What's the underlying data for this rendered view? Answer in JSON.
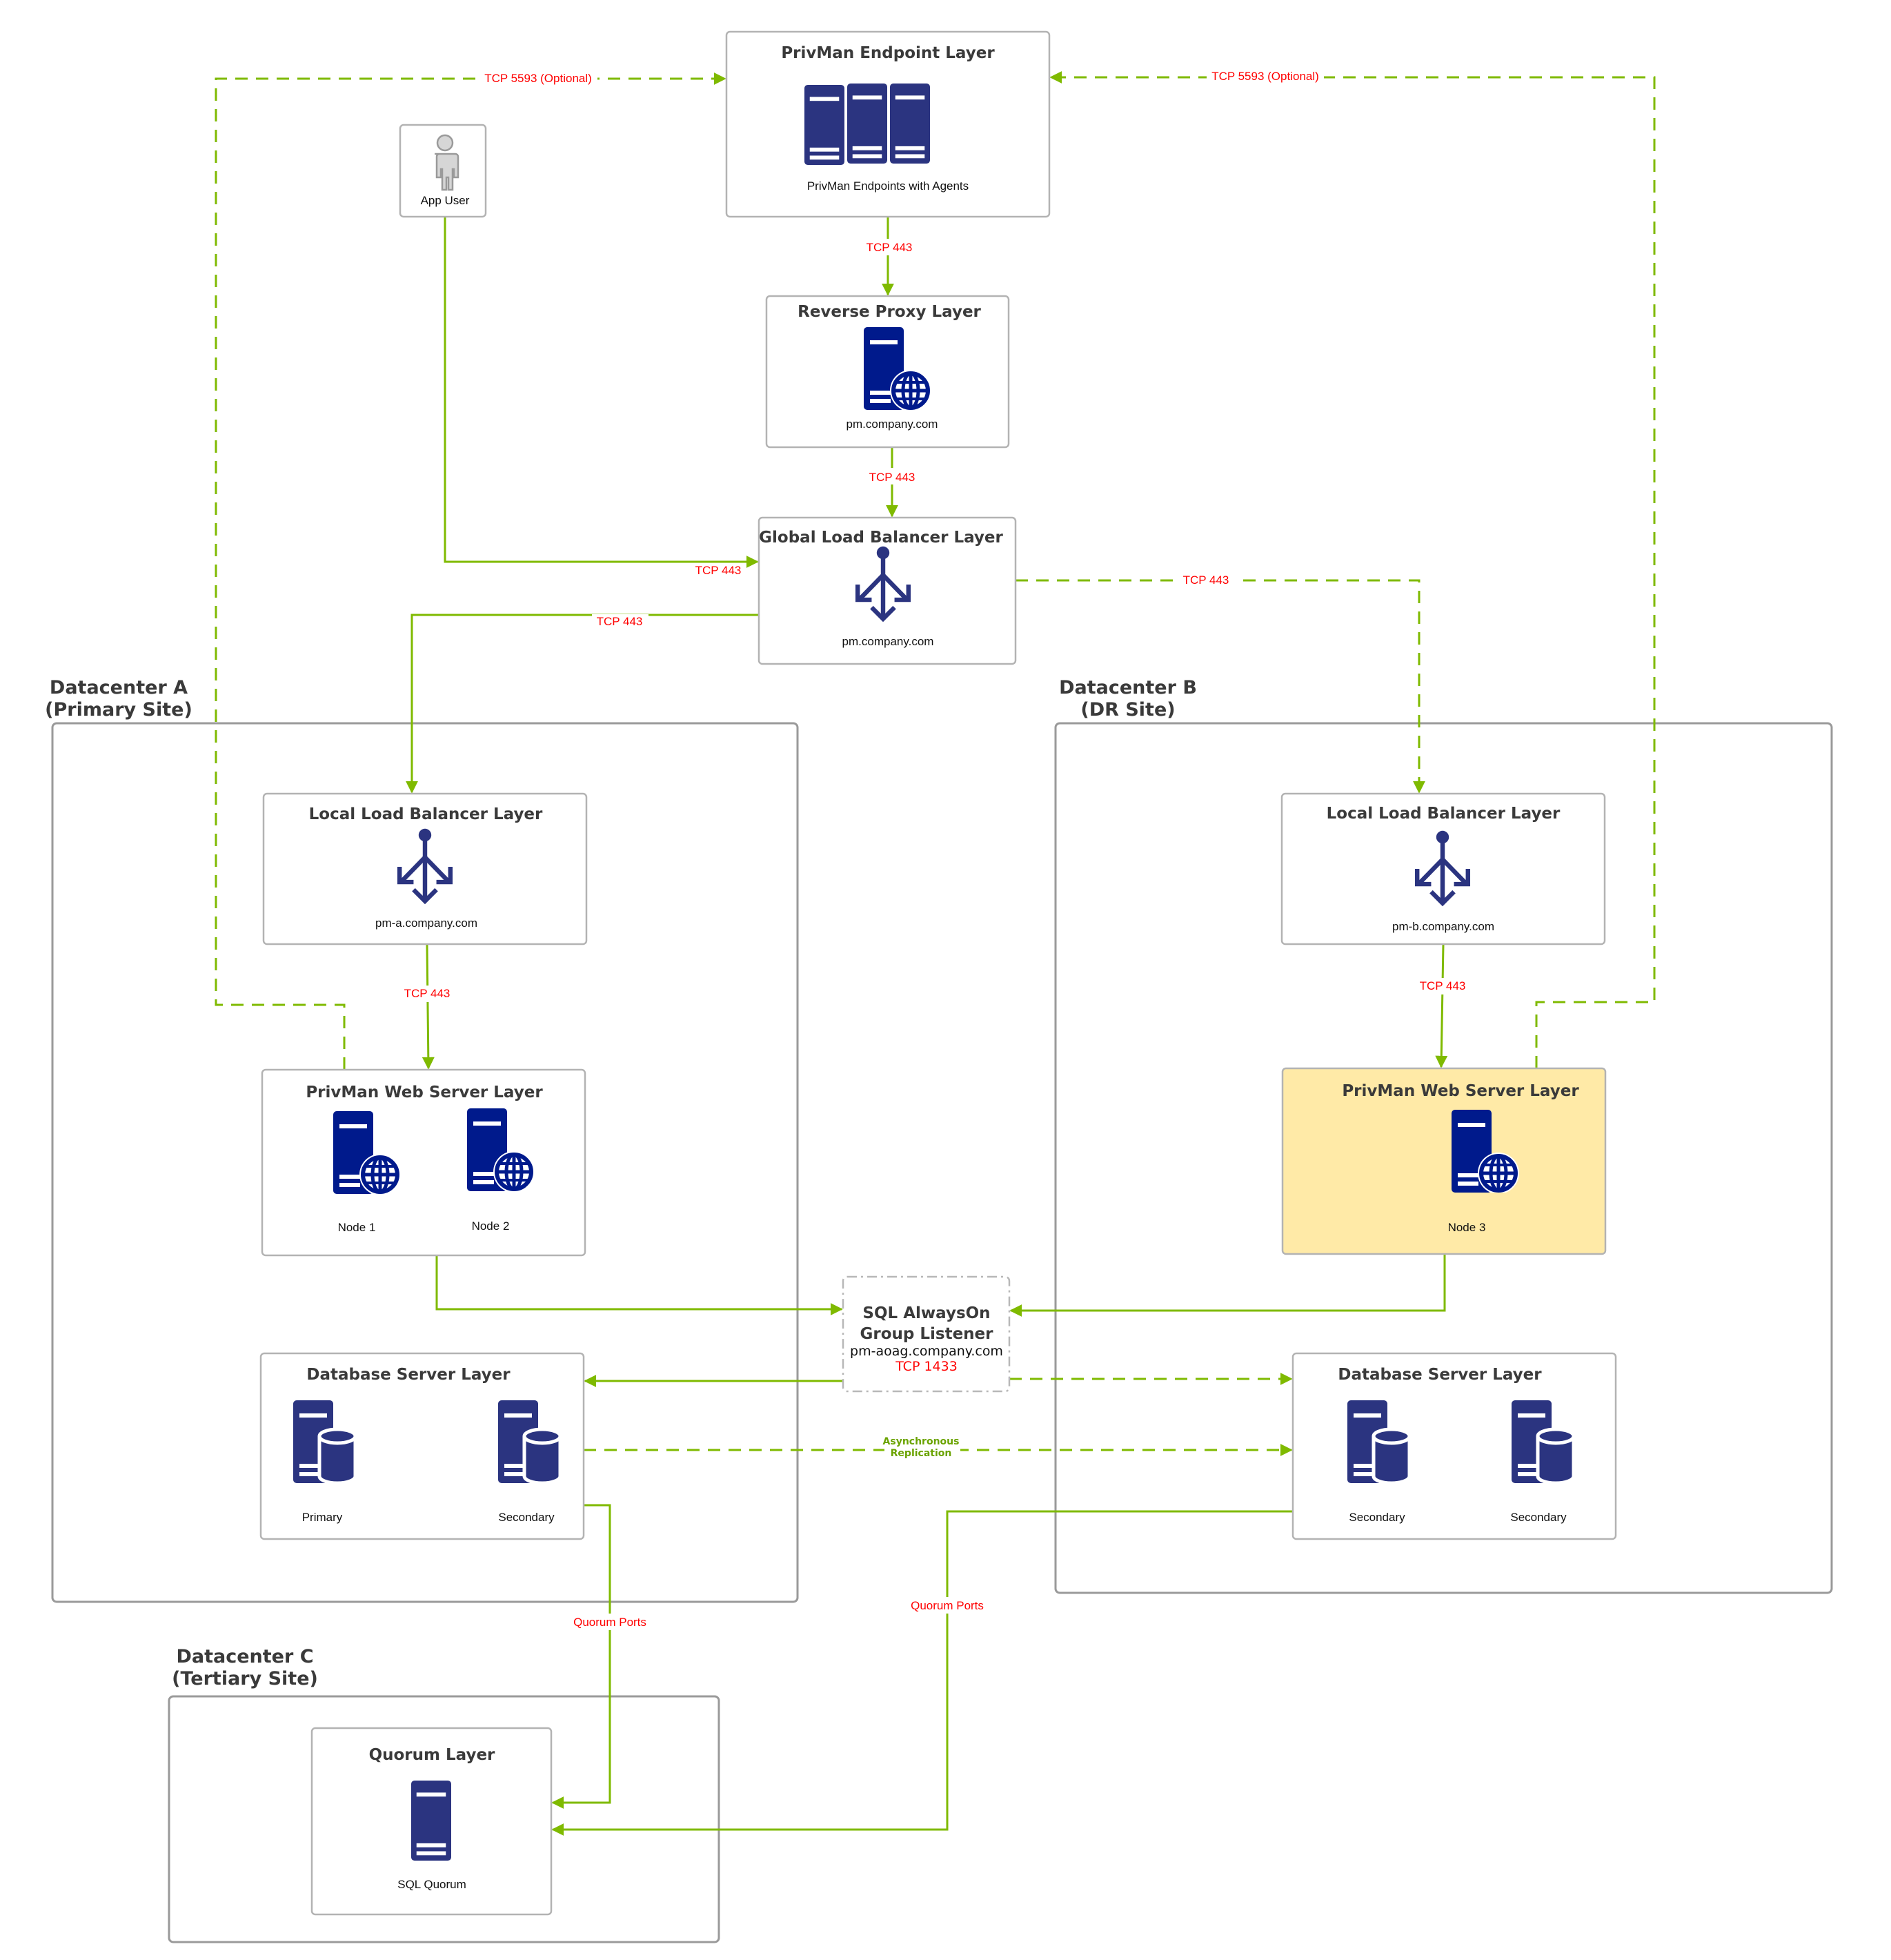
{
  "colors": {
    "connector": "#7fba00",
    "port_label": "#ff0000",
    "server_icon": "#2b3480",
    "web_server_icon": "#001a8c",
    "highlight_fill": "#ffeaa7",
    "box_border": "#b3b3b3"
  },
  "endpoint_layer": {
    "title": "PrivMan Endpoint Layer",
    "subtitle": "PrivMan Endpoints with Agents",
    "icon": "server-rack-icon"
  },
  "app_user": {
    "label": "App User",
    "icon": "user-icon"
  },
  "reverse_proxy": {
    "title": "Reverse Proxy Layer",
    "host": "pm.company.com",
    "icon": "web-server-icon"
  },
  "global_lb": {
    "title": "Global Load Balancer Layer",
    "host": "pm.company.com",
    "icon": "load-balancer-icon"
  },
  "datacenters": {
    "a": {
      "name": "Datacenter A",
      "site": "(Primary Site)",
      "local_lb": {
        "title": "Local Load Balancer Layer",
        "host": "pm-a.company.com"
      },
      "web_layer": {
        "title": "PrivMan Web Server Layer",
        "nodes": [
          "Node 1",
          "Node 2"
        ]
      },
      "db_layer": {
        "title": "Database Server Layer",
        "servers": [
          "Primary",
          "Secondary"
        ],
        "replication": [
          "Asynchronous",
          "Replication"
        ]
      }
    },
    "b": {
      "name": "Datacenter B",
      "site": "(DR Site)",
      "local_lb": {
        "title": "Local Load Balancer Layer",
        "host": "pm-b.company.com"
      },
      "web_layer": {
        "title": "PrivMan Web Server Layer",
        "nodes": [
          "Node 3"
        ]
      },
      "db_layer": {
        "title": "Database Server Layer",
        "servers": [
          "Secondary",
          "Secondary"
        ]
      }
    },
    "c": {
      "name": "Datacenter C",
      "site": "(Tertiary Site)",
      "quorum_layer": {
        "title": "Quorum Layer",
        "server": "SQL Quorum"
      }
    }
  },
  "sql_listener": {
    "title_line1": "SQL AlwaysOn",
    "title_line2": "Group Listener",
    "host": "pm-aoag.company.com",
    "port": "TCP 1433"
  },
  "connections": {
    "endpoint_to_proxy": "TCP 443",
    "proxy_to_glb": "TCP 443",
    "user_to_glb": "TCP 443",
    "glb_to_dca": "TCP 443",
    "glb_to_dcb": "TCP 443",
    "lb_a_to_web_a": "TCP 443",
    "lb_b_to_web_b": "TCP 443",
    "web_a_to_endpoint": "TCP 5593 (Optional)",
    "web_b_to_endpoint": "TCP 5593 (Optional)",
    "db_a_to_quorum": "Quorum Ports",
    "db_b_to_quorum": "Quorum Ports",
    "cross_site_replication": [
      "Asynchronous",
      "Replication"
    ]
  }
}
